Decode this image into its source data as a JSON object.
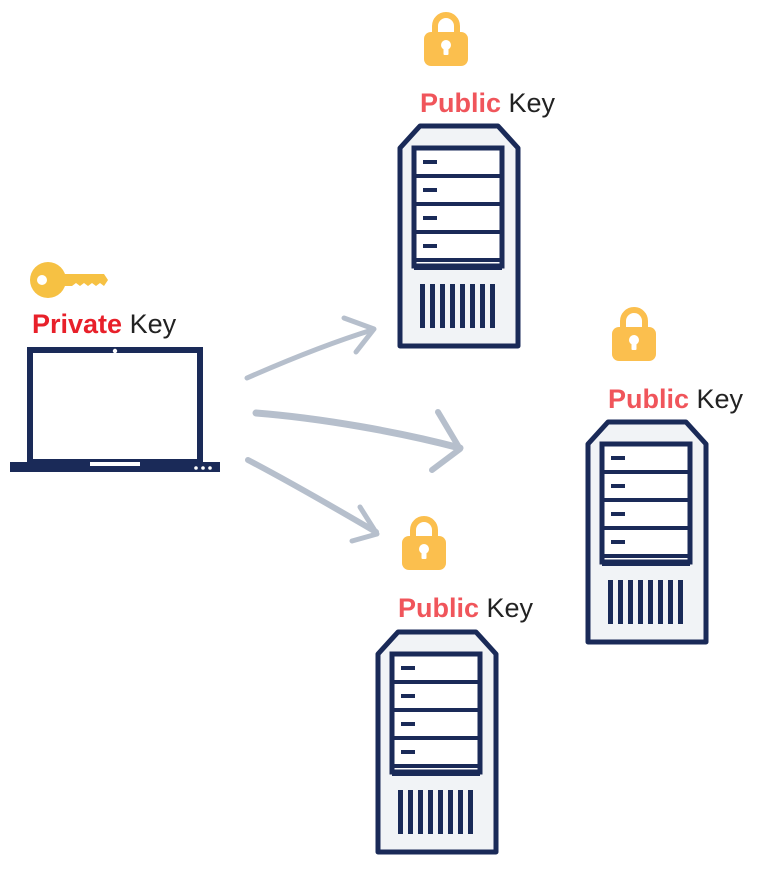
{
  "colors": {
    "private_accent": "#e8202a",
    "public_accent": "#f0555b",
    "navy": "#1a2a58",
    "lock_gold": "#fbbf4e",
    "key_gold": "#f6c143",
    "arrow_gray": "#b6bfcc"
  },
  "client": {
    "label_strong": "Private",
    "label_rest": "Key",
    "key_icon": "key-icon",
    "device_icon": "laptop-icon"
  },
  "servers": [
    {
      "label_strong": "Public",
      "label_rest": "Key",
      "lock_icon": "padlock-icon",
      "device_icon": "server-icon"
    },
    {
      "label_strong": "Public",
      "label_rest": "Key",
      "lock_icon": "padlock-icon",
      "device_icon": "server-icon"
    },
    {
      "label_strong": "Public",
      "label_rest": "Key",
      "lock_icon": "padlock-icon",
      "device_icon": "server-icon"
    }
  ]
}
